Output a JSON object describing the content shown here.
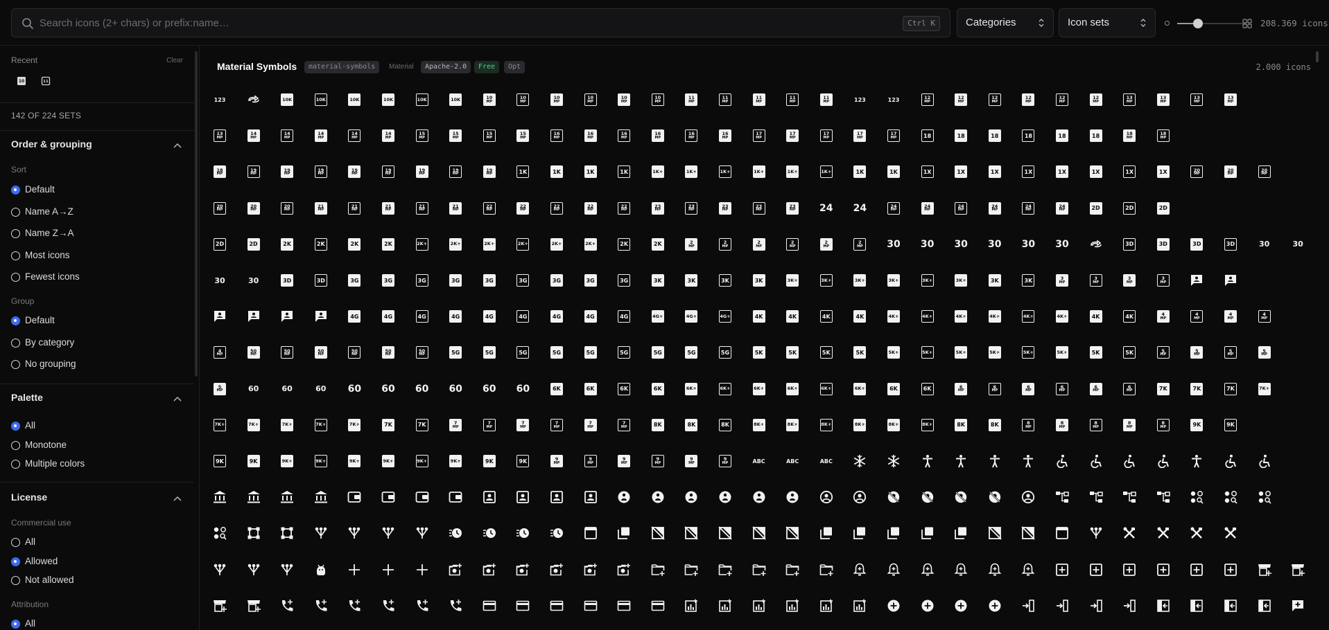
{
  "search": {
    "placeholder": "Search icons (2+ chars) or prefix:name…",
    "shortcut": "Ctrl K"
  },
  "filters": {
    "categories": "Categories",
    "icon_sets": "Icon sets"
  },
  "zoom": {
    "level": 0.3,
    "total_icons": "208.369 icons"
  },
  "sidebar": {
    "recent": {
      "label": "Recent",
      "clear": "Clear",
      "icons": [
        "ten-mp-icon",
        "eleven-mp-icon"
      ]
    },
    "sets_count": "142 OF 224 SETS",
    "order": {
      "title": "Order & grouping",
      "sort_label": "Sort",
      "sort_options": [
        {
          "label": "Default",
          "selected": true
        },
        {
          "label": "Name A→Z",
          "selected": false
        },
        {
          "label": "Name Z→A",
          "selected": false
        },
        {
          "label": "Most icons",
          "selected": false
        },
        {
          "label": "Fewest icons",
          "selected": false
        }
      ],
      "group_label": "Group",
      "group_options": [
        {
          "label": "Default",
          "selected": true
        },
        {
          "label": "By category",
          "selected": false
        },
        {
          "label": "No grouping",
          "selected": false
        }
      ]
    },
    "palette": {
      "title": "Palette",
      "options": [
        {
          "label": "All",
          "selected": true
        },
        {
          "label": "Monotone",
          "selected": false
        },
        {
          "label": "Multiple colors",
          "selected": false
        }
      ]
    },
    "license": {
      "title": "License",
      "commercial_label": "Commercial use",
      "commercial_options": [
        {
          "label": "All",
          "selected": false
        },
        {
          "label": "Allowed",
          "selected": true
        },
        {
          "label": "Not allowed",
          "selected": false
        }
      ],
      "attribution_label": "Attribution",
      "attribution_options": [
        {
          "label": "All",
          "selected": true
        }
      ]
    }
  },
  "set": {
    "title": "Material Symbols",
    "prefix": "material-symbols",
    "author": "Material",
    "license": "Apache-2.0",
    "free": "Free",
    "opt": "Opt",
    "count": "2.000 icons"
  },
  "icon_rows": [
    [
      "123",
      "sync-alt",
      "10K",
      "10K",
      "10K",
      "10K",
      "10K",
      "10K",
      "10MP",
      "10MP",
      "10MP",
      "10MP",
      "10MP",
      "10MP",
      "11MP",
      "11MP",
      "11MP",
      "11MP",
      "11MP",
      "123",
      "123",
      "12MP",
      "12MP",
      "12MP",
      "12MP",
      "12MP",
      "12MP",
      "13MP",
      "13MP",
      "13MP",
      "13MP"
    ],
    [
      "13MP",
      "14MP",
      "14MP",
      "14MP",
      "14MP",
      "14MP",
      "15MP",
      "15MP",
      "15MP",
      "15MP",
      "16MP",
      "16MP",
      "16MP",
      "16MP",
      "16MP",
      "16MP",
      "17MP",
      "17MP",
      "17MP",
      "17MP",
      "17MP",
      "18",
      "18",
      "18",
      "18",
      "18",
      "18",
      "18MP",
      "18MP"
    ],
    [
      "18MP",
      "19MP",
      "19MP",
      "19MP",
      "19MP",
      "19MP",
      "19MP",
      "19MP",
      "19MP",
      "1K",
      "1K",
      "1K",
      "1K",
      "1K+",
      "1K+",
      "1K+",
      "1K+",
      "1K+",
      "1K+",
      "1K",
      "1K",
      "1X",
      "1X",
      "1X",
      "1X",
      "1X",
      "1X",
      "1X",
      "1X",
      "20MP",
      "20MP",
      "20MP"
    ],
    [
      "20MP",
      "20MP",
      "20MP",
      "21MP",
      "21MP",
      "21MP",
      "21MP",
      "21MP",
      "22MP",
      "22MP",
      "22MP",
      "22MP",
      "22MP",
      "23MP",
      "23MP",
      "23MP",
      "23MP",
      "23MP",
      "24",
      "24",
      "24MP",
      "24MP",
      "24MP",
      "24MP",
      "24MP",
      "24MP",
      "2D",
      "2D",
      "2D"
    ],
    [
      "2D",
      "2D",
      "2K",
      "2K",
      "2K",
      "2K",
      "2K+",
      "2K+",
      "2K+",
      "2K+",
      "2K+",
      "2K+",
      "2K",
      "2K",
      "2MP",
      "2MP",
      "2MP",
      "2MP",
      "2MP",
      "2MP",
      "30",
      "30",
      "30",
      "30",
      "30",
      "30",
      "sync-alt",
      "3D",
      "3D",
      "3D",
      "3D",
      "30s",
      "30s"
    ],
    [
      "30s",
      "30s",
      "3D",
      "3D",
      "3G",
      "3G",
      "3G",
      "3G",
      "3G",
      "3G",
      "3G",
      "3G",
      "3G",
      "3K",
      "3K",
      "3K",
      "3K",
      "3K+",
      "3K+",
      "3K+",
      "3K+",
      "3K+",
      "3K+",
      "3K",
      "3K",
      "3MP",
      "3MP",
      "3MP",
      "3MP",
      "chat",
      "chat"
    ],
    [
      "chat",
      "chat",
      "chat",
      "chat",
      "4G",
      "4G",
      "4G",
      "4G",
      "4G",
      "4G",
      "4G",
      "4G",
      "4G",
      "4G+",
      "4G+",
      "4G+",
      "4K",
      "4K",
      "4K",
      "4K",
      "4K+",
      "4K+",
      "4K+",
      "4K+",
      "4K+",
      "4K+",
      "4K",
      "4K",
      "4MP",
      "4MP",
      "4MP",
      "4MP"
    ],
    [
      "4MP",
      "50MP",
      "50MP",
      "50MP",
      "50MP",
      "50MP",
      "50MP",
      "5G",
      "5G",
      "5G",
      "5G",
      "5G",
      "5G",
      "5G",
      "5G",
      "5G",
      "5K",
      "5K",
      "5K",
      "5K",
      "5K+",
      "5K+",
      "5K+",
      "5K+",
      "5K+",
      "5K+",
      "5K",
      "5K",
      "5MP",
      "5MP",
      "5MP",
      "5MP"
    ],
    [
      "5MP",
      "60fps",
      "60fps",
      "60fps",
      "60",
      "60",
      "60",
      "60",
      "60",
      "60",
      "6K",
      "6K",
      "6K",
      "6K",
      "6K+",
      "6K+",
      "6K+",
      "6K+",
      "6K+",
      "6K+",
      "6K",
      "6K",
      "6MP",
      "6MP",
      "6MP",
      "6MP",
      "6MP",
      "6MP",
      "7K",
      "7K",
      "7K",
      "7K+"
    ],
    [
      "7K+",
      "7K+",
      "7K+",
      "7K+",
      "7K+",
      "7K",
      "7K",
      "7MP",
      "7MP",
      "7MP",
      "7MP",
      "7MP",
      "7MP",
      "8K",
      "8K",
      "8K",
      "8K+",
      "8K+",
      "8K+",
      "8K+",
      "8K+",
      "8K+",
      "8K",
      "8K",
      "8MP",
      "8MP",
      "8MP",
      "8MP",
      "8MP",
      "9K",
      "9K"
    ],
    [
      "9K",
      "9K",
      "9K+",
      "9K+",
      "9K+",
      "9K+",
      "9K+",
      "9K+",
      "9K",
      "9K",
      "9MP",
      "9MP",
      "9MP",
      "9MP",
      "9MP",
      "9MP",
      "ABC",
      "ABC",
      "ABC",
      "snow",
      "snow",
      "access",
      "access",
      "access",
      "access",
      "wheel",
      "wheel",
      "wheel",
      "wheel",
      "access",
      "wheel",
      "wheel"
    ],
    [
      "bank",
      "bank",
      "bank",
      "bank",
      "wallet",
      "wallet",
      "wallet",
      "wallet",
      "id",
      "id",
      "id",
      "id",
      "pin",
      "pin",
      "pin",
      "pin",
      "pin",
      "pin",
      "acct",
      "acct",
      "noacct",
      "noacct",
      "noacct",
      "noacct",
      "acct",
      "tree",
      "tree",
      "tree",
      "tree",
      "dots",
      "dots",
      "dots"
    ],
    [
      "dots",
      "crop",
      "crop",
      "tree2",
      "tree2",
      "tree2",
      "tree2",
      "alarm",
      "alarm",
      "alarm",
      "alarm",
      "win",
      "lib",
      "nolib",
      "nolib",
      "nolib",
      "nolib",
      "nolib",
      "lib",
      "lib",
      "lib",
      "lib",
      "lib",
      "nolib",
      "nolib",
      "win",
      "tree2",
      "tools",
      "tools",
      "tools",
      "tools"
    ],
    [
      "tree2",
      "tree2",
      "tree2",
      "android",
      "plus",
      "plus",
      "plus",
      "cam",
      "cam",
      "cam",
      "cam",
      "cam",
      "cam",
      "folder",
      "folder",
      "folder",
      "folder",
      "folder",
      "folder",
      "bell",
      "bell",
      "bell",
      "bell",
      "bell",
      "bell",
      "box",
      "box",
      "box",
      "box",
      "box",
      "box",
      "store",
      "store"
    ],
    [
      "store",
      "store",
      "call",
      "call",
      "call",
      "call",
      "call",
      "call",
      "card",
      "card",
      "card",
      "card",
      "card",
      "card",
      "chart",
      "chart",
      "chart",
      "chart",
      "chart",
      "chart",
      "circ",
      "circ",
      "circ",
      "circ",
      "enter",
      "enter",
      "enter",
      "enter",
      "exit",
      "exit",
      "exit",
      "exit",
      "chatp"
    ]
  ]
}
